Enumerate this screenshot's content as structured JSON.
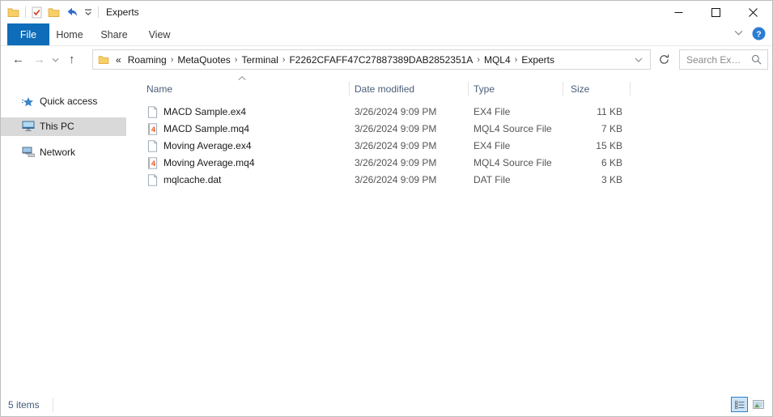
{
  "titlebar": {
    "title": "Experts",
    "quick_access_icons": [
      "folder-icon",
      "properties-check-icon",
      "new-folder-icon",
      "undo-icon",
      "qat-dropdown-icon"
    ]
  },
  "window_controls": [
    "minimize",
    "maximize",
    "close"
  ],
  "ribbon": {
    "tabs": [
      {
        "label": "File",
        "active": true
      },
      {
        "label": "Home",
        "active": false
      },
      {
        "label": "Share",
        "active": false
      },
      {
        "label": "View",
        "active": false
      }
    ],
    "right_icons": [
      "chevron-down-icon",
      "help-icon"
    ]
  },
  "navigation": {
    "back": "←",
    "forward": "→",
    "up": "↑",
    "recent_icon": "chevron-down-icon"
  },
  "address": {
    "overflow_prefix": "«",
    "separator": "›",
    "segments": [
      "Roaming",
      "MetaQuotes",
      "Terminal",
      "F2262CFAFF47C27887389DAB2852351A",
      "MQL4",
      "Experts"
    ],
    "dropdown_icon": "chevron-down-icon",
    "refresh_icon": "refresh-icon"
  },
  "search": {
    "placeholder": "Search Ex…",
    "icon": "magnifier-icon"
  },
  "sidebar": {
    "items": [
      {
        "label": "Quick access",
        "icon": "quick-access-star-icon",
        "selected": false
      },
      {
        "label": "This PC",
        "icon": "this-pc-monitor-icon",
        "selected": true
      },
      {
        "label": "Network",
        "icon": "network-icon",
        "selected": false
      }
    ]
  },
  "filelist": {
    "columns": [
      {
        "label": "Name",
        "sorted": "asc"
      },
      {
        "label": "Date modified",
        "sorted": null
      },
      {
        "label": "Type",
        "sorted": null
      },
      {
        "label": "Size",
        "sorted": null
      }
    ],
    "files": [
      {
        "name": "MACD Sample.ex4",
        "date_modified": "3/26/2024 9:09 PM",
        "type": "EX4 File",
        "size": "11 KB",
        "icon": "file-generic-icon"
      },
      {
        "name": "MACD Sample.mq4",
        "date_modified": "3/26/2024 9:09 PM",
        "type": "MQL4 Source File",
        "size": "7 KB",
        "icon": "mq4-file-icon"
      },
      {
        "name": "Moving Average.ex4",
        "date_modified": "3/26/2024 9:09 PM",
        "type": "EX4 File",
        "size": "15 KB",
        "icon": "file-generic-icon"
      },
      {
        "name": "Moving Average.mq4",
        "date_modified": "3/26/2024 9:09 PM",
        "type": "MQL4 Source File",
        "size": "6 KB",
        "icon": "mq4-file-icon"
      },
      {
        "name": "mqlcache.dat",
        "date_modified": "3/26/2024 9:09 PM",
        "type": "DAT File",
        "size": "3 KB",
        "icon": "file-generic-icon"
      }
    ]
  },
  "statusbar": {
    "item_count": "5 items",
    "view_toggles": [
      "details-view-icon",
      "thumbnail-view-icon"
    ],
    "active_view": "details-view"
  },
  "colors": {
    "tab_active_bg": "#0e6cb8",
    "tab_active_text": "#ffffff",
    "selected_sidebar_bg": "#d9d9d9",
    "header_text": "#4a5e78",
    "help_blue": "#2b7cd3",
    "undo_blue": "#2f6bce",
    "mq4_orange": "#e8551c",
    "folder_yellow": "#f7cf66",
    "view_selected_border": "#2f80c3",
    "view_selected_bg": "#cbe4f7"
  }
}
